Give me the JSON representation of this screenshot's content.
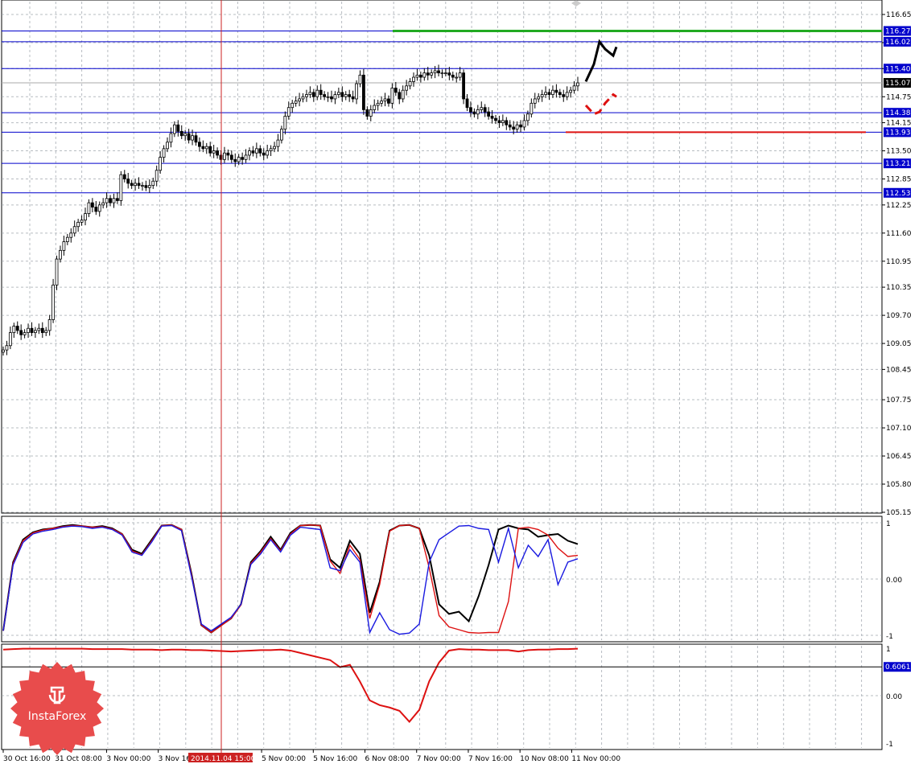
{
  "brand": {
    "name": "InstaForex",
    "color": "#e84c4c"
  },
  "colors": {
    "level_line": "#0000cc",
    "resistance": "#22aa22",
    "support": "#dd1111",
    "cursor_line": "#cc2222",
    "price_label_bg": "#000000",
    "grid": "#9aa0a8",
    "osc_black": "#000000",
    "osc_red": "#dd1111",
    "osc_blue": "#1a1ae0",
    "osc_purple": "#8844aa"
  },
  "chart_data": [
    {
      "type": "candlestick",
      "panel": "price",
      "y_ticks": [
        "116.65",
        "116.00",
        "115.40",
        "114.75",
        "114.15",
        "113.50",
        "112.85",
        "112.25",
        "111.60",
        "110.95",
        "110.35",
        "109.70",
        "109.05",
        "108.45",
        "107.75",
        "107.10",
        "106.45",
        "105.80",
        "105.15"
      ],
      "ylim": [
        105.15,
        116.65
      ],
      "level_labels": [
        {
          "label": "116.27",
          "value": 116.27,
          "kind": "level"
        },
        {
          "label": "116.02",
          "value": 116.02,
          "kind": "level"
        },
        {
          "label": "115.40",
          "value": 115.4,
          "kind": "level"
        },
        {
          "label": "115.07",
          "value": 115.07,
          "kind": "current"
        },
        {
          "label": "114.38",
          "value": 114.38,
          "kind": "level"
        },
        {
          "label": "113.93",
          "value": 113.93,
          "kind": "level"
        },
        {
          "label": "113.21",
          "value": 113.21,
          "kind": "level"
        },
        {
          "label": "112.53",
          "value": 112.53,
          "kind": "level"
        }
      ],
      "resistance": {
        "value": 116.27
      },
      "support": {
        "value": 113.93
      },
      "close_series": [
        108.9,
        109.0,
        109.3,
        109.45,
        109.35,
        109.25,
        109.3,
        109.4,
        109.3,
        109.35,
        109.4,
        109.3,
        109.35,
        109.6,
        110.4,
        111.0,
        111.2,
        111.4,
        111.5,
        111.6,
        111.75,
        111.85,
        111.9,
        112.05,
        112.3,
        112.2,
        112.1,
        112.25,
        112.3,
        112.4,
        112.3,
        112.4,
        112.35,
        112.95,
        112.85,
        112.75,
        112.7,
        112.75,
        112.7,
        112.7,
        112.65,
        112.7,
        112.8,
        113.05,
        113.35,
        113.55,
        113.7,
        113.9,
        114.1,
        113.95,
        113.85,
        113.9,
        113.75,
        113.85,
        113.7,
        113.6,
        113.55,
        113.6,
        113.45,
        113.5,
        113.4,
        113.3,
        113.45,
        113.4,
        113.3,
        113.25,
        113.35,
        113.3,
        113.4,
        113.5,
        113.45,
        113.55,
        113.45,
        113.4,
        113.5,
        113.55,
        113.6,
        113.75,
        114.0,
        114.3,
        114.5,
        114.6,
        114.65,
        114.7,
        114.75,
        114.8,
        114.85,
        114.75,
        114.9,
        114.8,
        114.75,
        114.75,
        114.7,
        114.8,
        114.85,
        114.75,
        114.8,
        114.75,
        114.7,
        115.05,
        115.25,
        114.45,
        114.3,
        114.45,
        114.55,
        114.6,
        114.65,
        114.7,
        114.6,
        114.95,
        114.85,
        114.7,
        114.9,
        115.0,
        115.1,
        115.2,
        115.25,
        115.2,
        115.3,
        115.25,
        115.3,
        115.35,
        115.3,
        115.3,
        115.3,
        115.25,
        115.2,
        115.2,
        115.3,
        114.7,
        114.5,
        114.4,
        114.35,
        114.45,
        114.5,
        114.4,
        114.3,
        114.25,
        114.2,
        114.15,
        114.2,
        114.1,
        114.05,
        114.0,
        114.1,
        114.05,
        114.2,
        114.35,
        114.6,
        114.7,
        114.75,
        114.8,
        114.85,
        114.8,
        114.9,
        114.85,
        114.8,
        114.75,
        114.85,
        114.9,
        115.0,
        115.07
      ],
      "forecast_up": [
        115.1,
        115.5,
        116.02,
        115.85,
        115.7,
        115.9
      ],
      "forecast_down": [
        114.55,
        114.35,
        114.4,
        114.6,
        114.8,
        114.75
      ],
      "cursor_time": "2014.11.04 15:00"
    },
    {
      "type": "line",
      "panel": "oscillator",
      "y_ticks": [
        "1",
        "0.00",
        "-1"
      ],
      "ylim": [
        -1,
        1
      ],
      "series": [
        {
          "color": "#000000",
          "values": [
            -0.92,
            0.3,
            0.7,
            0.83,
            0.88,
            0.9,
            0.94,
            0.96,
            0.94,
            0.92,
            0.94,
            0.9,
            0.8,
            0.52,
            0.45,
            0.7,
            0.95,
            0.96,
            0.88,
            0.1,
            -0.82,
            -0.95,
            -0.82,
            -0.7,
            -0.45,
            0.3,
            0.5,
            0.75,
            0.52,
            0.82,
            0.95,
            0.96,
            0.95,
            0.35,
            0.2,
            0.68,
            0.45,
            -0.6,
            -0.05,
            0.86,
            0.95,
            0.96,
            0.9,
            0.42,
            -0.45,
            -0.62,
            -0.58,
            -0.75,
            -0.3,
            0.25,
            0.88,
            0.95,
            0.9,
            0.88,
            0.75,
            0.78,
            0.8,
            0.68,
            0.62
          ]
        },
        {
          "color": "#dd1111",
          "values": [
            -0.92,
            0.28,
            0.68,
            0.82,
            0.87,
            0.9,
            0.93,
            0.95,
            0.94,
            0.92,
            0.93,
            0.89,
            0.8,
            0.5,
            0.43,
            0.68,
            0.95,
            0.96,
            0.88,
            0.08,
            -0.82,
            -0.95,
            -0.83,
            -0.7,
            -0.46,
            0.28,
            0.48,
            0.72,
            0.5,
            0.8,
            0.95,
            0.96,
            0.95,
            0.32,
            0.1,
            0.6,
            0.35,
            -0.7,
            -0.1,
            0.85,
            0.95,
            0.96,
            0.9,
            0.2,
            -0.65,
            -0.85,
            -0.9,
            -0.95,
            -0.96,
            -0.95,
            -0.95,
            -0.4,
            0.9,
            0.92,
            0.88,
            0.78,
            0.55,
            0.4,
            0.42
          ]
        },
        {
          "color": "#1a1ae0",
          "values": [
            -0.92,
            0.25,
            0.65,
            0.8,
            0.85,
            0.88,
            0.92,
            0.94,
            0.93,
            0.9,
            0.92,
            0.88,
            0.78,
            0.48,
            0.42,
            0.66,
            0.94,
            0.95,
            0.86,
            0.05,
            -0.8,
            -0.92,
            -0.8,
            -0.68,
            -0.45,
            0.26,
            0.45,
            0.7,
            0.48,
            0.78,
            0.92,
            0.9,
            0.88,
            0.2,
            0.15,
            0.52,
            0.3,
            -0.95,
            -0.6,
            -0.9,
            -0.98,
            -0.96,
            -0.8,
            0.3,
            0.7,
            0.82,
            0.94,
            0.95,
            0.9,
            0.88,
            0.3,
            0.9,
            0.2,
            0.6,
            0.4,
            0.7,
            -0.1,
            0.3,
            0.36
          ]
        }
      ]
    },
    {
      "type": "line",
      "panel": "sub",
      "y_ticks": [
        "1",
        "0.00",
        "-1"
      ],
      "ylim": [
        -1,
        1
      ],
      "current_label": "0.6061",
      "current_value": 0.6061,
      "series": [
        {
          "color": "#dd1111",
          "values": [
            0.97,
            0.98,
            0.99,
            0.99,
            0.99,
            0.99,
            0.99,
            0.99,
            0.99,
            0.98,
            0.98,
            0.98,
            0.98,
            0.97,
            0.97,
            0.97,
            0.96,
            0.97,
            0.97,
            0.96,
            0.96,
            0.95,
            0.94,
            0.93,
            0.94,
            0.95,
            0.96,
            0.96,
            0.97,
            0.95,
            0.9,
            0.85,
            0.8,
            0.75,
            0.6,
            0.65,
            0.3,
            -0.1,
            -0.2,
            -0.25,
            -0.32,
            -0.55,
            -0.3,
            0.3,
            0.7,
            0.95,
            0.98,
            0.97,
            0.97,
            0.96,
            0.96,
            0.96,
            0.93,
            0.96,
            0.97,
            0.97,
            0.98,
            0.98,
            0.99
          ]
        }
      ]
    }
  ],
  "time_axis": {
    "ticks": [
      {
        "label": "30 Oct 16:00",
        "pos": 0.0
      },
      {
        "label": "31 Oct 08:00",
        "pos": 0.0587
      },
      {
        "label": "3 Nov 00:00",
        "pos": 0.1174
      },
      {
        "label": "3 Nov 16:00",
        "pos": 0.1761
      },
      {
        "label": "5 Nov 00:00",
        "pos": 0.2935
      },
      {
        "label": "5 Nov 16:00",
        "pos": 0.3522
      },
      {
        "label": "6 Nov 08:00",
        "pos": 0.4109
      },
      {
        "label": "7 Nov 00:00",
        "pos": 0.4696
      },
      {
        "label": "7 Nov 16:00",
        "pos": 0.5283
      },
      {
        "label": "10 Nov 08:00",
        "pos": 0.587
      },
      {
        "label": "11 Nov 00:00",
        "pos": 0.6457
      }
    ],
    "cursor_label": "2014.11.04 15:00"
  }
}
